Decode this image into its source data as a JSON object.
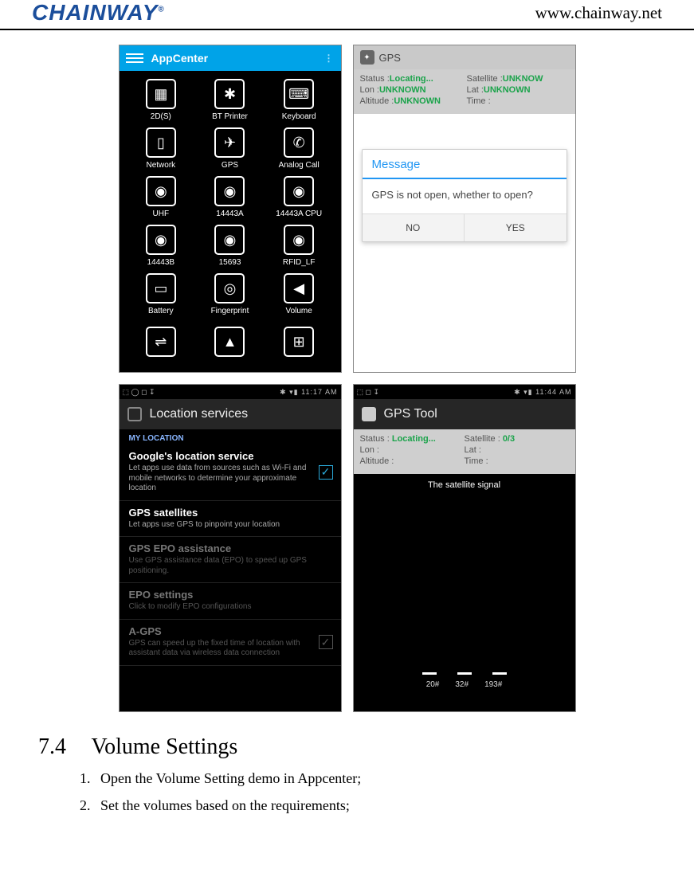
{
  "header": {
    "brand": "CHAINWAY",
    "reg": "®",
    "url": "www.chainway.net"
  },
  "screen1": {
    "title": "AppCenter",
    "menu_glyph": "⋮",
    "apps": [
      {
        "icon": "▦",
        "label": "2D(S)"
      },
      {
        "icon": "✱",
        "label": "BT Printer"
      },
      {
        "icon": "⌨",
        "label": "Keyboard"
      },
      {
        "icon": "▯",
        "label": "Network"
      },
      {
        "icon": "✈",
        "label": "GPS"
      },
      {
        "icon": "✆",
        "label": "Analog Call"
      },
      {
        "icon": "◉",
        "label": "UHF"
      },
      {
        "icon": "◉",
        "label": "14443A"
      },
      {
        "icon": "◉",
        "label": "14443A CPU"
      },
      {
        "icon": "◉",
        "label": "14443B"
      },
      {
        "icon": "◉",
        "label": "15693"
      },
      {
        "icon": "◉",
        "label": "RFID_LF"
      },
      {
        "icon": "▭",
        "label": "Battery"
      },
      {
        "icon": "◎",
        "label": "Fingerprint"
      },
      {
        "icon": "◀",
        "label": "Volume"
      }
    ],
    "partial_icons": [
      "⇌",
      "▲",
      "⊞"
    ]
  },
  "screen2": {
    "title": "GPS",
    "rows": [
      {
        "k": "Status :",
        "v": "Locating..."
      },
      {
        "k": "Satellite :",
        "v": "UNKNOW"
      },
      {
        "k": "Lon :",
        "v": "UNKNOWN"
      },
      {
        "k": "Lat :",
        "v": "UNKNOWN"
      },
      {
        "k": "Altitude :",
        "v": "UNKNOWN"
      },
      {
        "k": "Time :",
        "v": ""
      }
    ],
    "dialog_title": "Message",
    "dialog_body": "GPS is not open, whether to open?",
    "btn_no": "NO",
    "btn_yes": "YES"
  },
  "screen3": {
    "status_left": "⬚ ◯ ◻ ↧",
    "status_right": "✱ ▾▮ 11:17 AM",
    "header": "Location services",
    "section_label": "MY LOCATION",
    "items": [
      {
        "title": "Google's location service",
        "desc": "Let apps use data from sources such as Wi-Fi and mobile networks to determine your approximate location",
        "checked": true,
        "enabled": true
      },
      {
        "title": "GPS satellites",
        "desc": "Let apps use GPS to pinpoint your location",
        "checked": false,
        "enabled": true,
        "hide_box": true
      },
      {
        "title": "GPS EPO assistance",
        "desc": "Use GPS assistance data (EPO) to speed up GPS positioning.",
        "checked": false,
        "enabled": false,
        "hide_box": true
      },
      {
        "title": "EPO settings",
        "desc": "Click to modify EPO configurations",
        "checked": false,
        "enabled": false,
        "hide_box": true
      },
      {
        "title": "A-GPS",
        "desc": "GPS can speed up the fixed time of location with assistant data via wireless data connection",
        "checked": true,
        "enabled": false
      }
    ]
  },
  "screen4": {
    "status_left": "⬚ ◻ ↧",
    "status_right": "✱ ▾▮ 11:44 AM",
    "header": "GPS Tool",
    "rows": [
      {
        "k": "Status :",
        "v": "Locating...",
        "green": true
      },
      {
        "k": "Satellite :",
        "v": "0/3",
        "green": true
      },
      {
        "k": "Lon :",
        "v": ""
      },
      {
        "k": "Lat :",
        "v": ""
      },
      {
        "k": "Altitude :",
        "v": ""
      },
      {
        "k": "Time :",
        "v": ""
      }
    ],
    "sig_title": "The satellite signal",
    "bar_labels": [
      "20#",
      "32#",
      "193#"
    ]
  },
  "document": {
    "section_num": "7.4",
    "section_title": "Volume Settings",
    "steps": [
      "Open the Volume Setting demo in Appcenter;",
      "Set the volumes based on the requirements;"
    ]
  }
}
